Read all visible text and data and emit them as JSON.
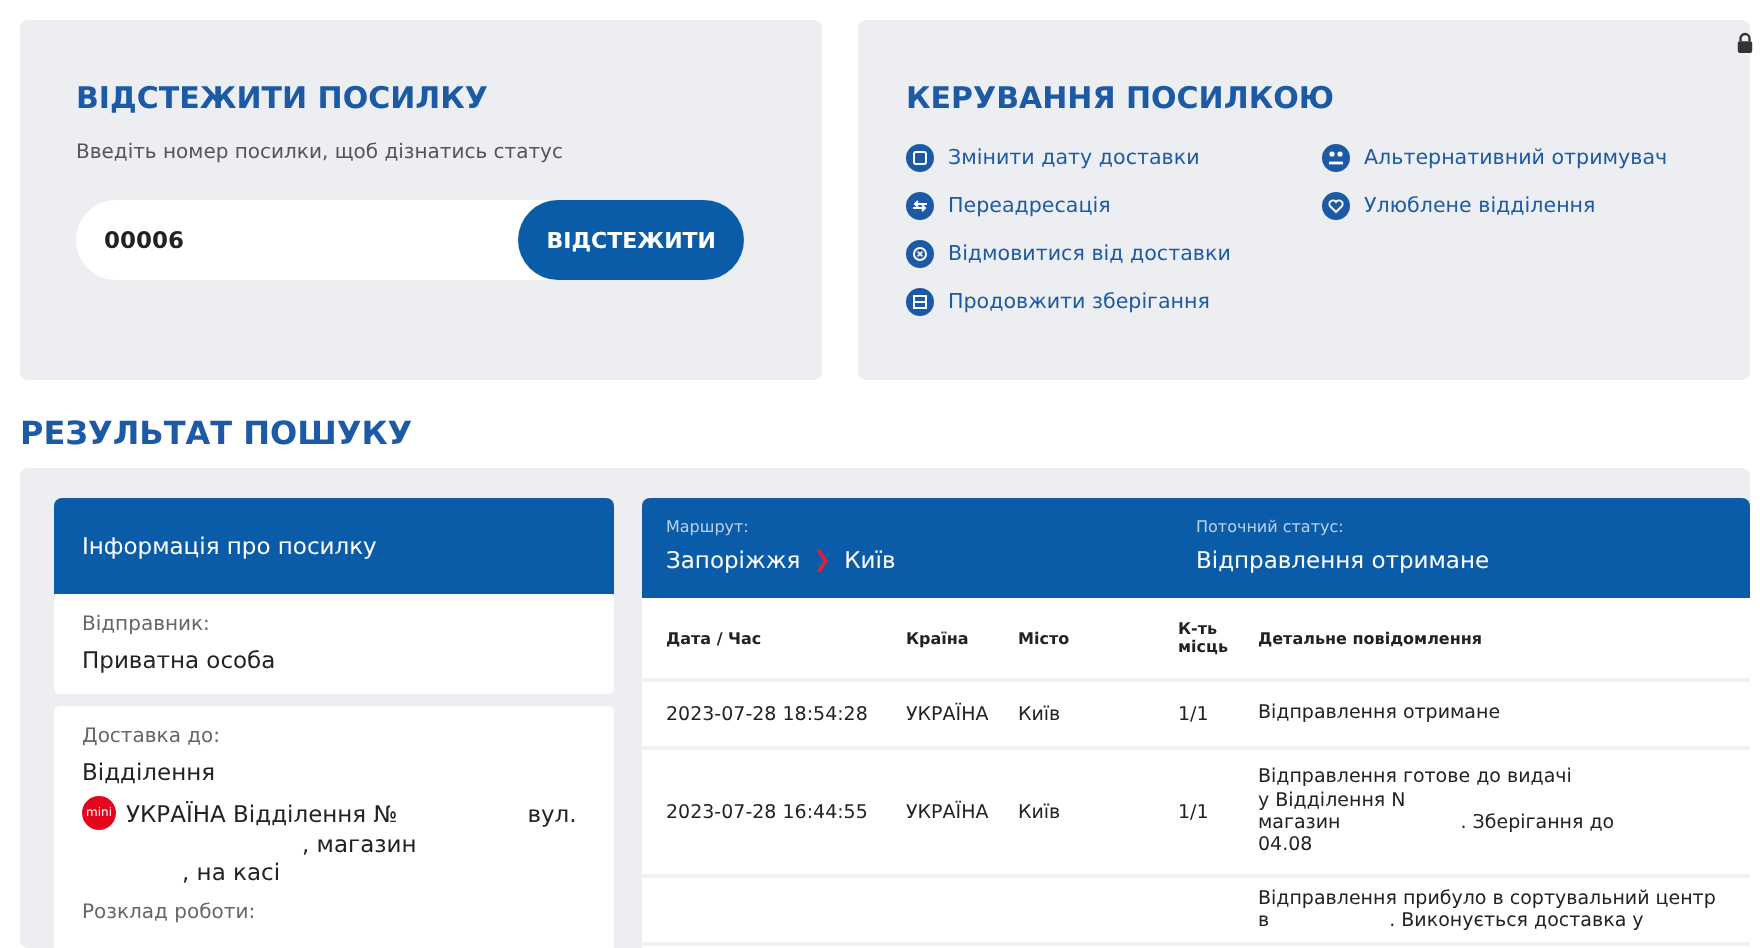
{
  "track": {
    "title": "ВІДСТЕЖИТИ ПОСИЛКУ",
    "hint": "Введіть номер посилки, щоб дізнатись статус",
    "value": "00006",
    "button": "ВІДСТЕЖИТИ"
  },
  "manage": {
    "title": "КЕРУВАННЯ ПОСИЛКОЮ",
    "actions": [
      {
        "label": "Змінити дату доставки",
        "kind": "calendar"
      },
      {
        "label": "Переадресація",
        "kind": "redirect"
      },
      {
        "label": "Відмовитися від доставки",
        "kind": "cancel"
      },
      {
        "label": "Продовжити зберігання",
        "kind": "storage"
      },
      {
        "label": "Альтернативний отримувач",
        "kind": "person"
      },
      {
        "label": "Улюблене відділення",
        "kind": "heart"
      }
    ]
  },
  "results": {
    "title": "РЕЗУЛЬТАТ ПОШУКУ",
    "info": {
      "header": "Інформація про посилку",
      "sender_label": "Відправник:",
      "sender": "Приватна особа",
      "delivery_label": "Доставка до:",
      "delivery_type": "Відділення",
      "badge": "mini",
      "address_lines": [
        "УКРАЇНА Відділення №",
        "вул.",
        ", магазин",
        ", на касі"
      ],
      "schedule_label": "Розклад роботи:"
    },
    "route": {
      "label": "Маршрут:",
      "from": "Запоріжжя",
      "to": "Київ",
      "status_label": "Поточний статус:",
      "status": "Відправлення отримане"
    },
    "table": {
      "columns": [
        "Дата / Час",
        "Країна",
        "Місто",
        "К-ть місць",
        "Детальне повідомлення"
      ],
      "rows": [
        {
          "date": "2023-07-28 18:54:28",
          "country": "УКРАЇНА",
          "city": "Київ",
          "count": "1/1",
          "message": [
            [
              "Відправлення отримане"
            ]
          ]
        },
        {
          "date": "2023-07-28 16:44:55",
          "country": "УКРАЇНА",
          "city": "Київ",
          "count": "1/1",
          "message": [
            [
              "Відправлення готове до видачі"
            ],
            [
              "у Відділення N"
            ],
            [
              "магазин",
              ". Зберігання до"
            ],
            [
              "04.08"
            ]
          ]
        },
        {
          "message": [
            [
              "Відправлення прибуло в сортувальний центр"
            ],
            [
              "в",
              ". Виконується доставка у"
            ]
          ]
        }
      ]
    }
  }
}
